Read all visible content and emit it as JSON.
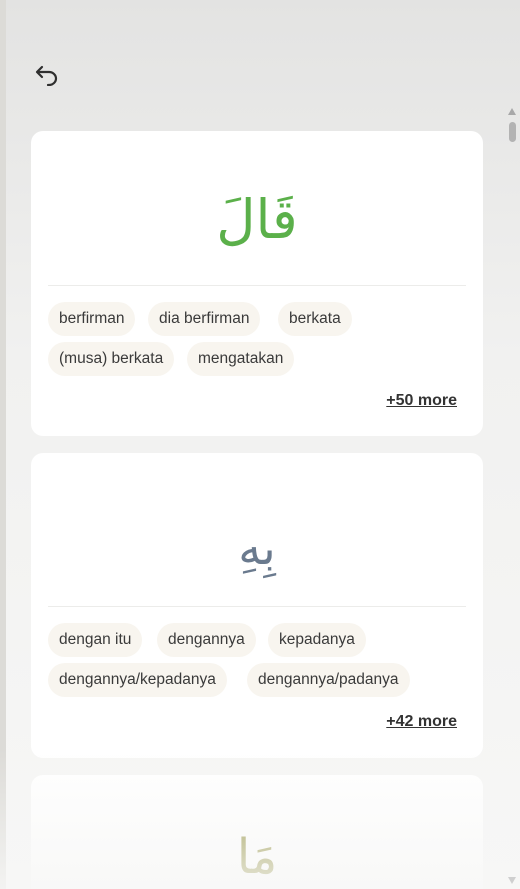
{
  "cards": [
    {
      "arabic": "قَالَ",
      "color": "#5bb04a",
      "meanings": [
        "berfirman",
        "dia berfirman",
        "berkata",
        "(musa) berkata",
        "mengatakan"
      ],
      "more": "+50 more"
    },
    {
      "arabic": "بِهِ",
      "color": "#6a7a8e",
      "accent_color": "#b5272e",
      "meanings": [
        "dengan itu",
        "dengannya",
        "kepadanya",
        "dengannya/kepadanya",
        "dengannya/padanya"
      ],
      "more": "+42 more"
    },
    {
      "arabic": "مَا",
      "color": "#8c8a33"
    }
  ],
  "icons": {
    "back": "undo-arrow-icon"
  }
}
